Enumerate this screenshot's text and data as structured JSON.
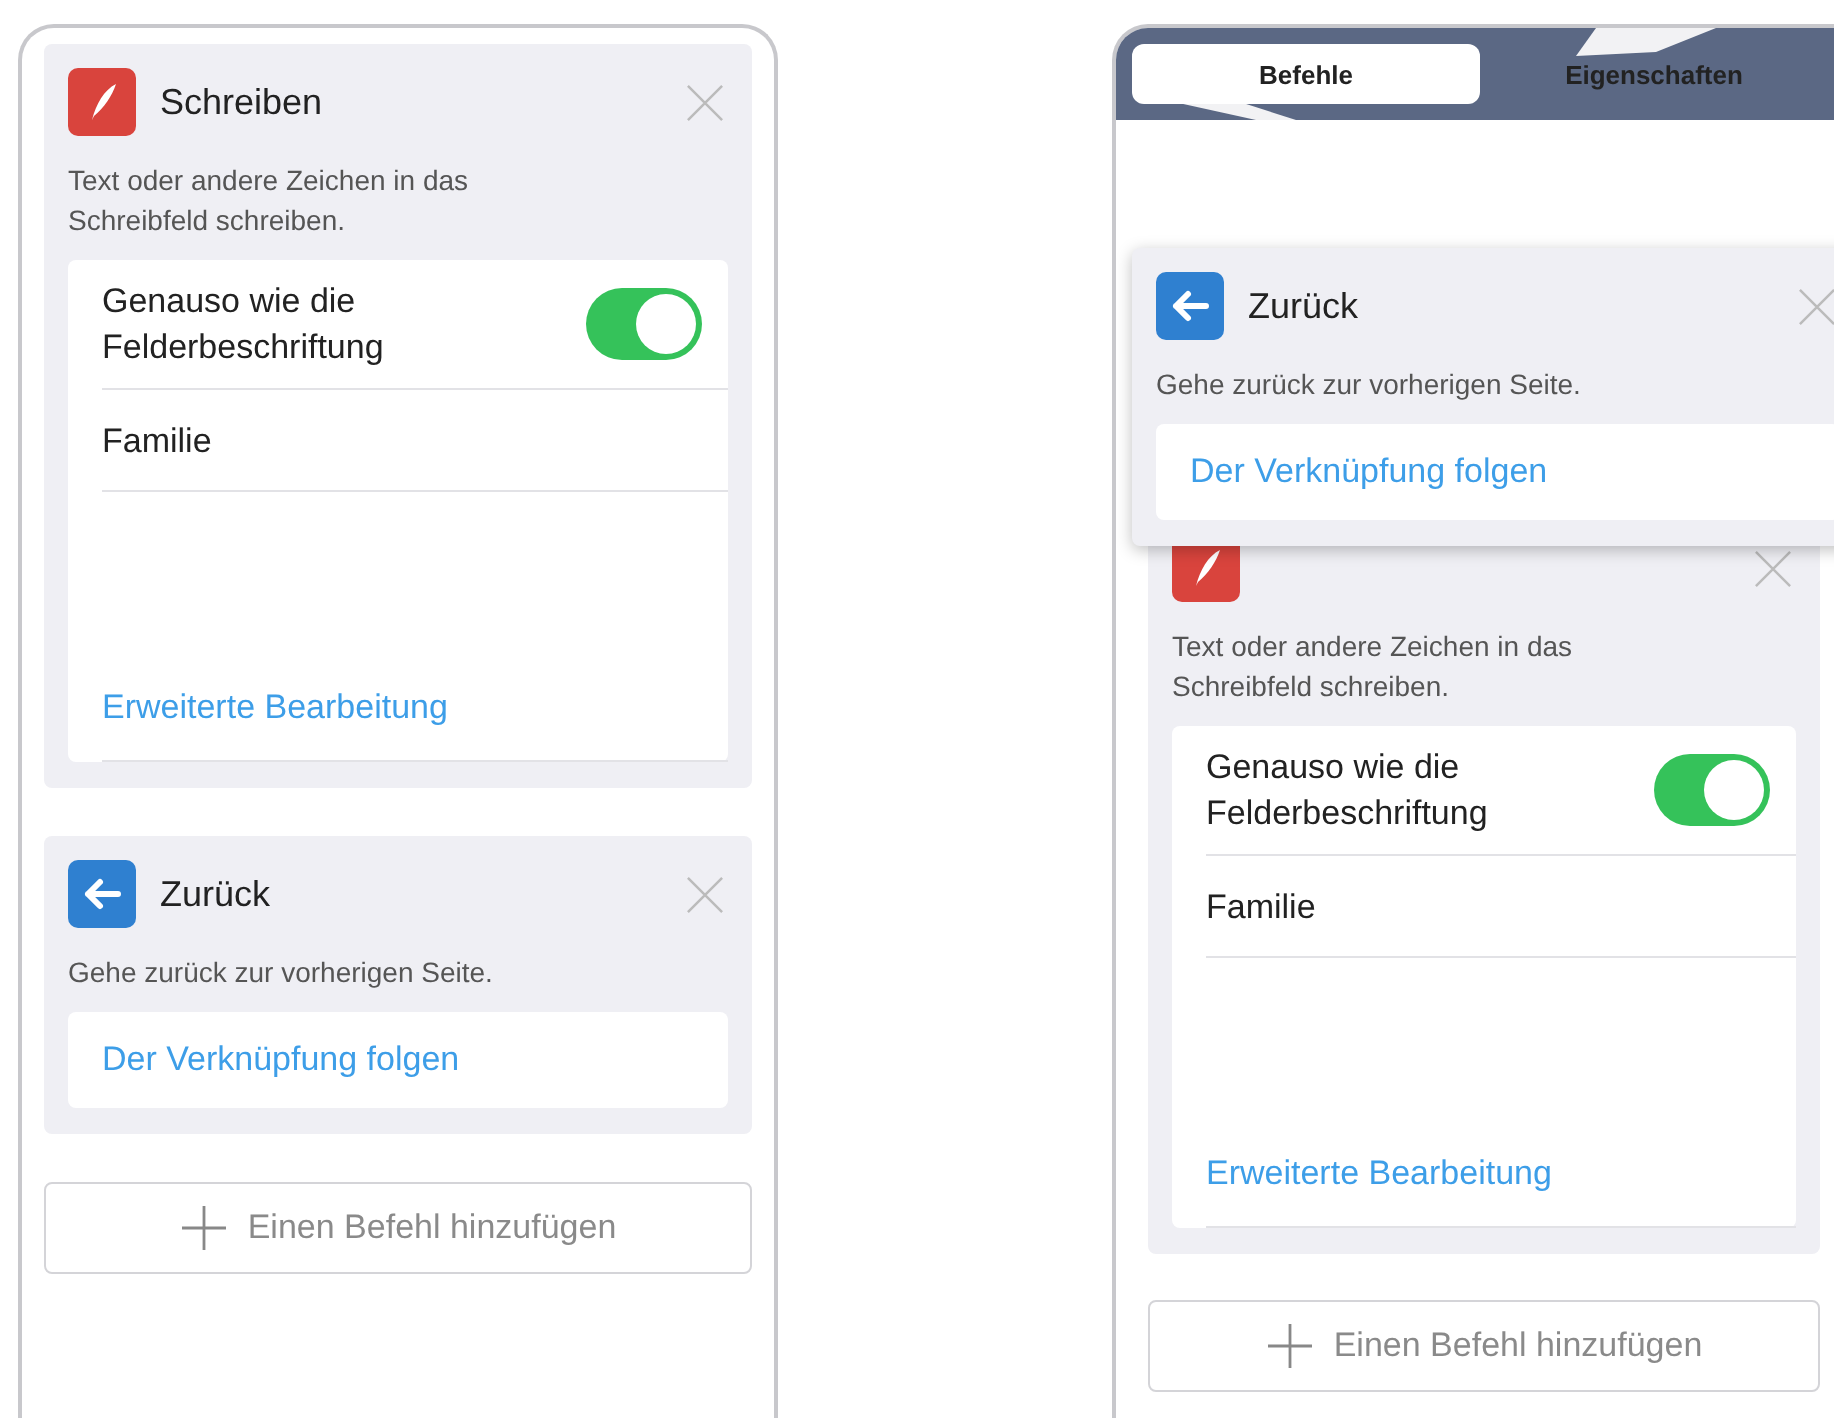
{
  "left_screen": {
    "cards": [
      {
        "kind": "write",
        "title": "Schreiben",
        "description": "Text oder andere Zeichen in das Schreibfeld schreiben.",
        "toggle": {
          "label": "Genauso wie die Felderbeschriftung",
          "on": true
        },
        "field": {
          "value": "Familie"
        },
        "link": "Erweiterte Bearbeitung"
      },
      {
        "kind": "back",
        "title": "Zurück",
        "description": "Gehe zurück zur vorherigen Seite.",
        "link": "Der Verknüpfung folgen"
      }
    ],
    "add_button": "Einen Befehl hinzufügen"
  },
  "right_screen": {
    "tabs": [
      {
        "label": "Befehle",
        "selected": true
      },
      {
        "label": "Eigenschaften",
        "selected": false
      }
    ],
    "dragged_card": {
      "kind": "back",
      "title": "Zurück",
      "description": "Gehe zurück zur vorherigen Seite.",
      "link": "Der Verknüpfung folgen"
    },
    "cards": [
      {
        "kind": "write",
        "description": "Text oder andere Zeichen in das Schreibfeld schreiben.",
        "toggle": {
          "label": "Genauso wie die Felderbeschriftung",
          "on": true
        },
        "field": {
          "value": "Familie"
        },
        "link": "Erweiterte Bearbeitung"
      }
    ],
    "add_button": "Einen Befehl hinzufügen"
  }
}
